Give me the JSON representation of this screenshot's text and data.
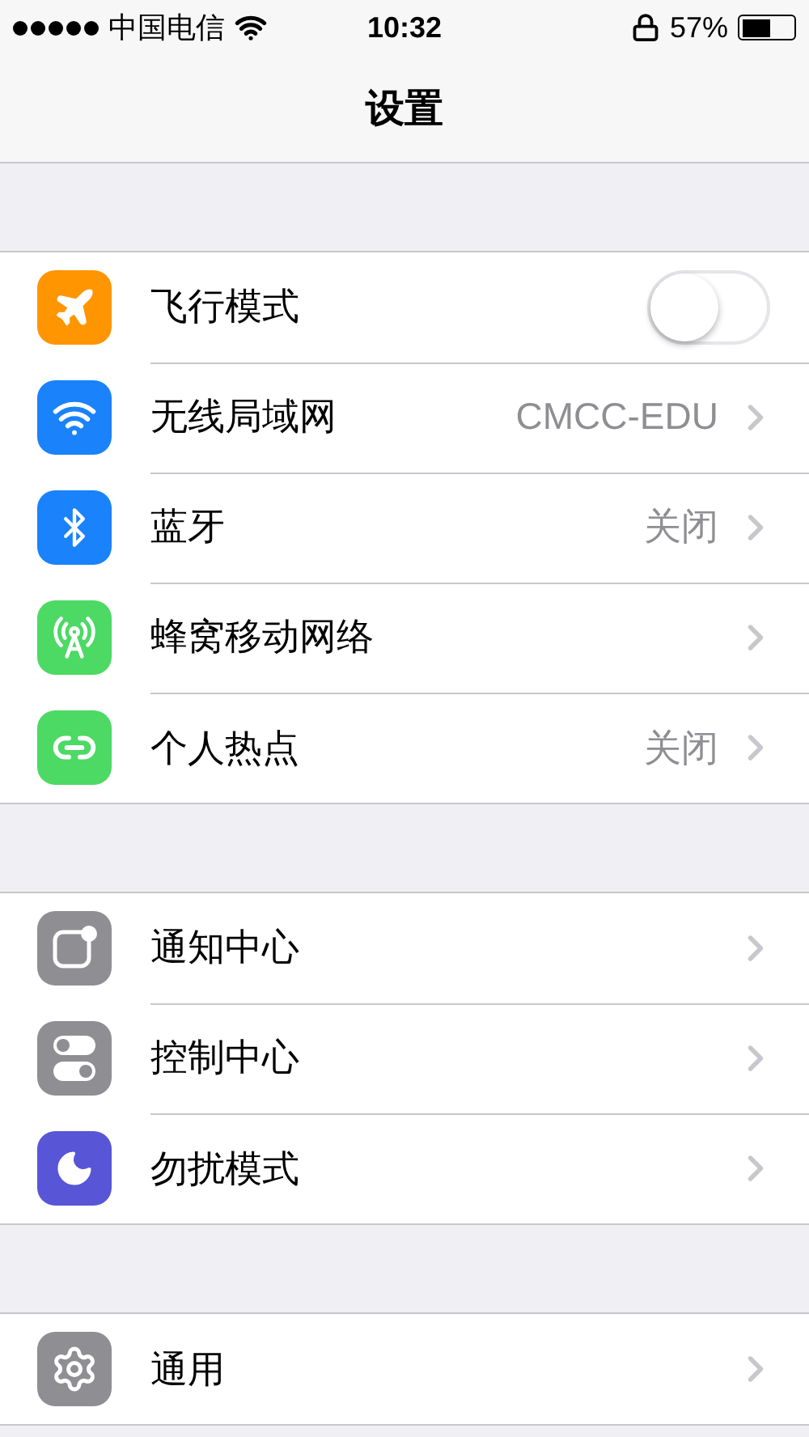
{
  "status_bar": {
    "carrier": "中国电信",
    "time": "10:32",
    "battery": "57%"
  },
  "nav": {
    "title": "设置"
  },
  "groups": [
    {
      "items": [
        {
          "label": "飞行模式",
          "kind": "toggle",
          "on": false,
          "color": "#ff9500"
        },
        {
          "label": "无线局域网",
          "kind": "link",
          "value": "CMCC-EDU",
          "color": "#1a82fb"
        },
        {
          "label": "蓝牙",
          "kind": "link",
          "value": "关闭",
          "color": "#1a82fb"
        },
        {
          "label": "蜂窝移动网络",
          "kind": "link",
          "color": "#4cd964"
        },
        {
          "label": "个人热点",
          "kind": "link",
          "value": "关闭",
          "color": "#4cd964"
        }
      ]
    },
    {
      "items": [
        {
          "label": "通知中心",
          "kind": "link",
          "color": "#8e8e93"
        },
        {
          "label": "控制中心",
          "kind": "link",
          "color": "#8e8e93"
        },
        {
          "label": "勿扰模式",
          "kind": "link",
          "color": "#5856d6"
        }
      ]
    },
    {
      "items": [
        {
          "label": "通用",
          "kind": "link",
          "color": "#8e8e93"
        }
      ]
    }
  ]
}
